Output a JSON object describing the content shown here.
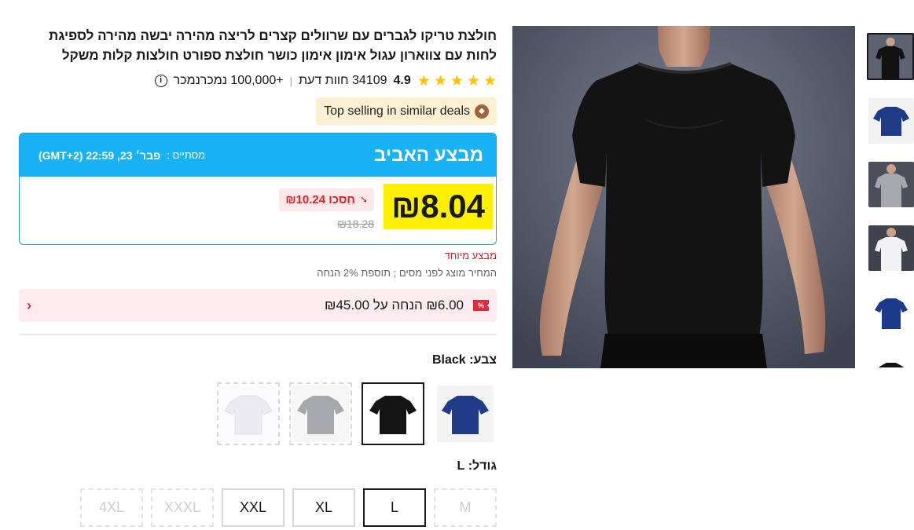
{
  "product": {
    "title": "חולצת טריקו לגברים עם שרוולים קצרים לריצה מהירה יבשה מהירה לספיגת לחות עם צווארון עגול אימון אימון כושר חולצת ספורט חולצות קלות משקל",
    "rating": "4.9",
    "reviews": "34109 חוות דעת",
    "separator": "|",
    "sold": "+100,000 נמכרנמכר",
    "info_icon": "i",
    "star_icon": "★"
  },
  "badge": {
    "label": "Top selling in similar deals",
    "icon": "tag-icon"
  },
  "deal": {
    "name": "מבצע האביב",
    "ends_label": "מסתיים :",
    "ends_time": "פבר׳ 23, 22:59 (GMT+2)",
    "price": "₪8.04",
    "save": "חסכו ₪10.24",
    "original_price": "₪18.28"
  },
  "special_label": "מבצע מיוחד",
  "tax_note": "המחיר מוצג לפני מסים ; תוספת 2% הנחה",
  "coupon": {
    "icon_text": "%",
    "text": "₪6.00 הנחה על ₪45.00",
    "chevron": "‹"
  },
  "color": {
    "label": "צבע: Black",
    "options": [
      {
        "name": "Navy",
        "fill": "#1f3b86"
      },
      {
        "name": "Black",
        "fill": "#141414"
      },
      {
        "name": "Gray",
        "fill": "#a6a8ab"
      },
      {
        "name": "White",
        "fill": "#f4f4f6"
      }
    ]
  },
  "size": {
    "label": "גודל: L",
    "options": [
      "M",
      "L",
      "XL",
      "XXL",
      "XXXL",
      "4XL"
    ]
  },
  "colors": {
    "accent_blue": "#19b3f5",
    "highlight": "#fff000",
    "red": "#e6283c",
    "badge_bg": "#fcf0d3"
  }
}
